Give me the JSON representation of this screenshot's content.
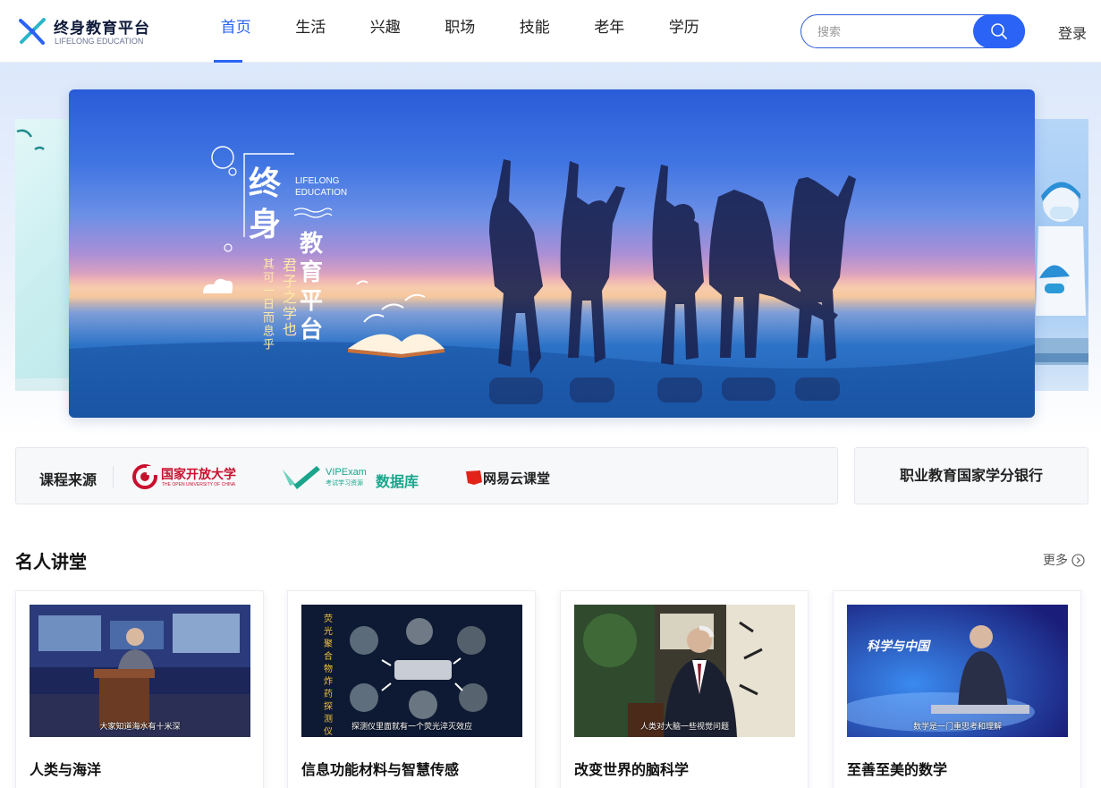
{
  "brand": {
    "title": "终身教育平台",
    "subtitle": "LIFELONG EDUCATION"
  },
  "nav": {
    "items": [
      {
        "label": "首页",
        "active": true
      },
      {
        "label": "生活"
      },
      {
        "label": "兴趣"
      },
      {
        "label": "职场"
      },
      {
        "label": "技能"
      },
      {
        "label": "老年"
      },
      {
        "label": "学历"
      }
    ]
  },
  "search": {
    "placeholder": "搜索",
    "icon": "search-icon"
  },
  "login_label": "登录",
  "banner": {
    "char_1": "终",
    "char_2": "身",
    "en_line1": "LIFELONG",
    "en_line2": "EDUCATION",
    "char_3": "教",
    "char_4": "育",
    "char_5": "平",
    "char_6": "台",
    "vertical_1": "君子之学也",
    "vertical_2": "其可一日而息乎"
  },
  "sources": {
    "label": "课程来源",
    "logos": [
      {
        "name": "open-university-logo",
        "text": "国家开放大学",
        "subtext": "THE OPEN UNIVERSITY OF CHINA",
        "color": "#c8102e"
      },
      {
        "name": "vipexam-logo",
        "text": "VIPExam",
        "subtext": "考试学习资源",
        "text2": "数据库",
        "color": "#1aa58c"
      },
      {
        "name": "netease-cloud-classroom-logo",
        "text": "网易云课堂",
        "color": "#e2231a"
      }
    ]
  },
  "credit_bank": "职业教育国家学分银行",
  "lectures": {
    "title": "名人讲堂",
    "more_label": "更多",
    "items": [
      {
        "title": "人类与海洋",
        "caption": "大家知道海水有十米深"
      },
      {
        "title": "信息功能材料与智慧传感",
        "caption": "探测仪里面就有一个荧光淬灭效应",
        "side_text": "荧光聚合物炸药探测仪"
      },
      {
        "title": "改变世界的脑科学",
        "caption": "人类对大脑一些视觉问题"
      },
      {
        "title": "至善至美的数学",
        "caption": "数学是一门重思考和理解",
        "show_logo": "科学与中国"
      }
    ]
  }
}
